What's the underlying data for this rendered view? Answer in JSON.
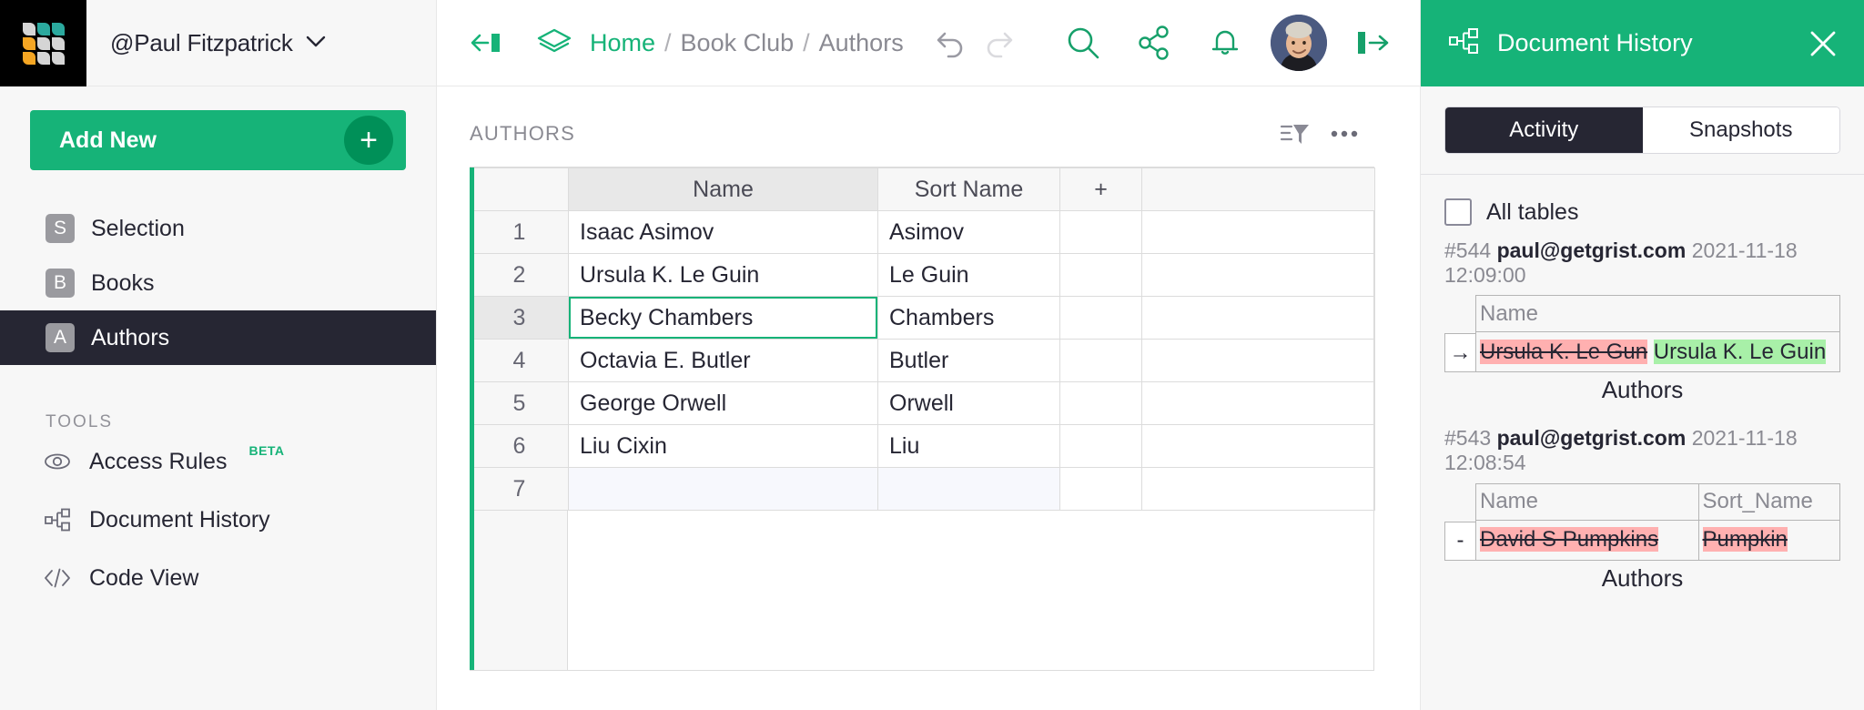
{
  "brand": {
    "accent_green": "#16b378",
    "dark": "#262633",
    "logo_teal": "#2ba99e",
    "logo_orange": "#f5a623",
    "logo_gray": "#d5d5d5"
  },
  "account": {
    "name": "@Paul Fitzpatrick",
    "chevron": "chevron-down-icon"
  },
  "sidebar": {
    "add_new_label": "Add New",
    "pages": [
      {
        "badge": "S",
        "label": "Selection",
        "selected": false
      },
      {
        "badge": "B",
        "label": "Books",
        "selected": false
      },
      {
        "badge": "A",
        "label": "Authors",
        "selected": true
      }
    ],
    "tools_title": "TOOLS",
    "tools": [
      {
        "icon": "eye-icon",
        "label": "Access Rules",
        "badge": "BETA"
      },
      {
        "icon": "branching-icon",
        "label": "Document History",
        "badge": ""
      },
      {
        "icon": "code-icon",
        "label": "Code View",
        "badge": ""
      }
    ]
  },
  "topbar": {
    "collapse_icon": "collapse-left-icon",
    "doc_icon": "layers-icon",
    "breadcrumb": {
      "home": "Home",
      "sep": "/",
      "items": [
        "Book Club",
        "Authors"
      ]
    },
    "undo_icon": "undo-icon",
    "redo_icon": "redo-icon",
    "search_icon": "search-icon",
    "share_icon": "share-icon",
    "bell_icon": "bell-icon",
    "avatar": "user-avatar",
    "exit_icon": "exit-icon"
  },
  "sheet": {
    "title": "AUTHORS",
    "sort_filter_icon": "sort-filter-icon",
    "more_icon": "more-options-icon",
    "columns": [
      "",
      "Name",
      "Sort Name",
      "+",
      ""
    ],
    "selected_column": "Name",
    "add_column_label": "+",
    "rows": [
      {
        "num": "1",
        "name": "Isaac Asimov",
        "sort_name": "Asimov"
      },
      {
        "num": "2",
        "name": "Ursula K. Le Guin",
        "sort_name": "Le Guin"
      },
      {
        "num": "3",
        "name": "Becky Chambers",
        "sort_name": "Chambers"
      },
      {
        "num": "4",
        "name": "Octavia E. Butler",
        "sort_name": "Butler"
      },
      {
        "num": "5",
        "name": "George Orwell",
        "sort_name": "Orwell"
      },
      {
        "num": "6",
        "name": "Liu Cixin",
        "sort_name": "Liu"
      },
      {
        "num": "7",
        "name": "",
        "sort_name": ""
      }
    ],
    "selected_cell": {
      "row": "3",
      "column": "Name",
      "value": "Becky Chambers"
    }
  },
  "right_panel": {
    "title": "Document History",
    "title_icon": "branching-icon",
    "close_icon": "close-icon",
    "tabs": [
      {
        "label": "Activity",
        "active": true
      },
      {
        "label": "Snapshots",
        "active": false
      }
    ],
    "all_tables": {
      "label": "All tables",
      "checked": false
    },
    "entries": [
      {
        "id": "#544",
        "email": "paul@getgrist.com",
        "timestamp": "2021-11-18 12:09:00",
        "marker": "→",
        "columns": [
          "Name"
        ],
        "cells": [
          {
            "deleted": "Ursula K. Le Gun",
            "inserted": "Ursula K. Le Guin"
          }
        ],
        "caption": "Authors"
      },
      {
        "id": "#543",
        "email": "paul@getgrist.com",
        "timestamp": "2021-11-18 12:08:54",
        "marker": "-",
        "columns": [
          "Name",
          "Sort_Name"
        ],
        "cells": [
          {
            "deleted": "David S Pumpkins",
            "inserted": ""
          },
          {
            "deleted": "Pumpkin",
            "inserted": ""
          }
        ],
        "caption": "Authors"
      }
    ]
  }
}
